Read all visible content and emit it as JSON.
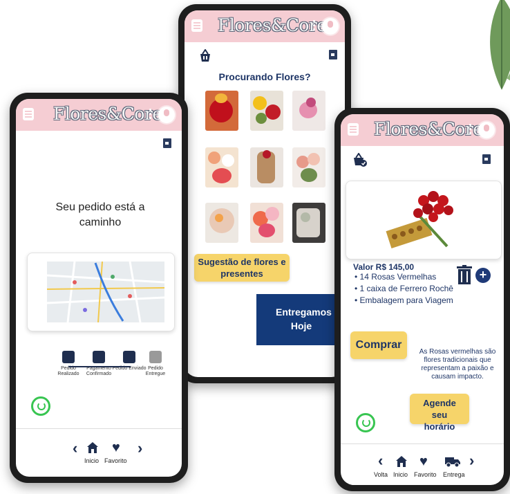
{
  "app": {
    "brand": "Flores&Cores"
  },
  "left_phone": {
    "message": "Seu pedido está a caminho",
    "steps": [
      "Pedido Realizado",
      "Pagamento Confirmado",
      "Pedido Enviado",
      "Pedido Entregue"
    ],
    "nav": [
      "Inicio",
      "Favorito"
    ]
  },
  "center_phone": {
    "heading": "Procurando Flores?",
    "suggestion_button": "Sugestão de flores e presentes",
    "delivery_banner": "Entregamos Hoje"
  },
  "right_phone": {
    "price": "Valor R$ 145,00",
    "items": [
      "14 Rosas Vermelhas",
      "1 caixa de Ferrero Rochê",
      "Embalagem para Viagem"
    ],
    "buy_button": "Comprar",
    "description": "As Rosas vermelhas são flores tradicionais que representam a paixão e causam impacto.",
    "schedule_button": "Agende seu horário",
    "nav": [
      "Volta",
      "Inicio",
      "Favorito",
      "Entrega"
    ]
  },
  "colors": {
    "topbar": "#f5cdd3",
    "navy": "#1f2e4f",
    "yellow": "#f6d46a",
    "banner": "#143a7a",
    "whatsapp": "#38c551"
  },
  "icons": [
    "menu-icon",
    "user-icon",
    "exit-icon",
    "basket-icon",
    "trash-icon",
    "plus-icon",
    "whatsapp-icon",
    "home-icon",
    "heart-icon",
    "truck-icon",
    "chevron-left-icon",
    "chevron-right-icon"
  ]
}
